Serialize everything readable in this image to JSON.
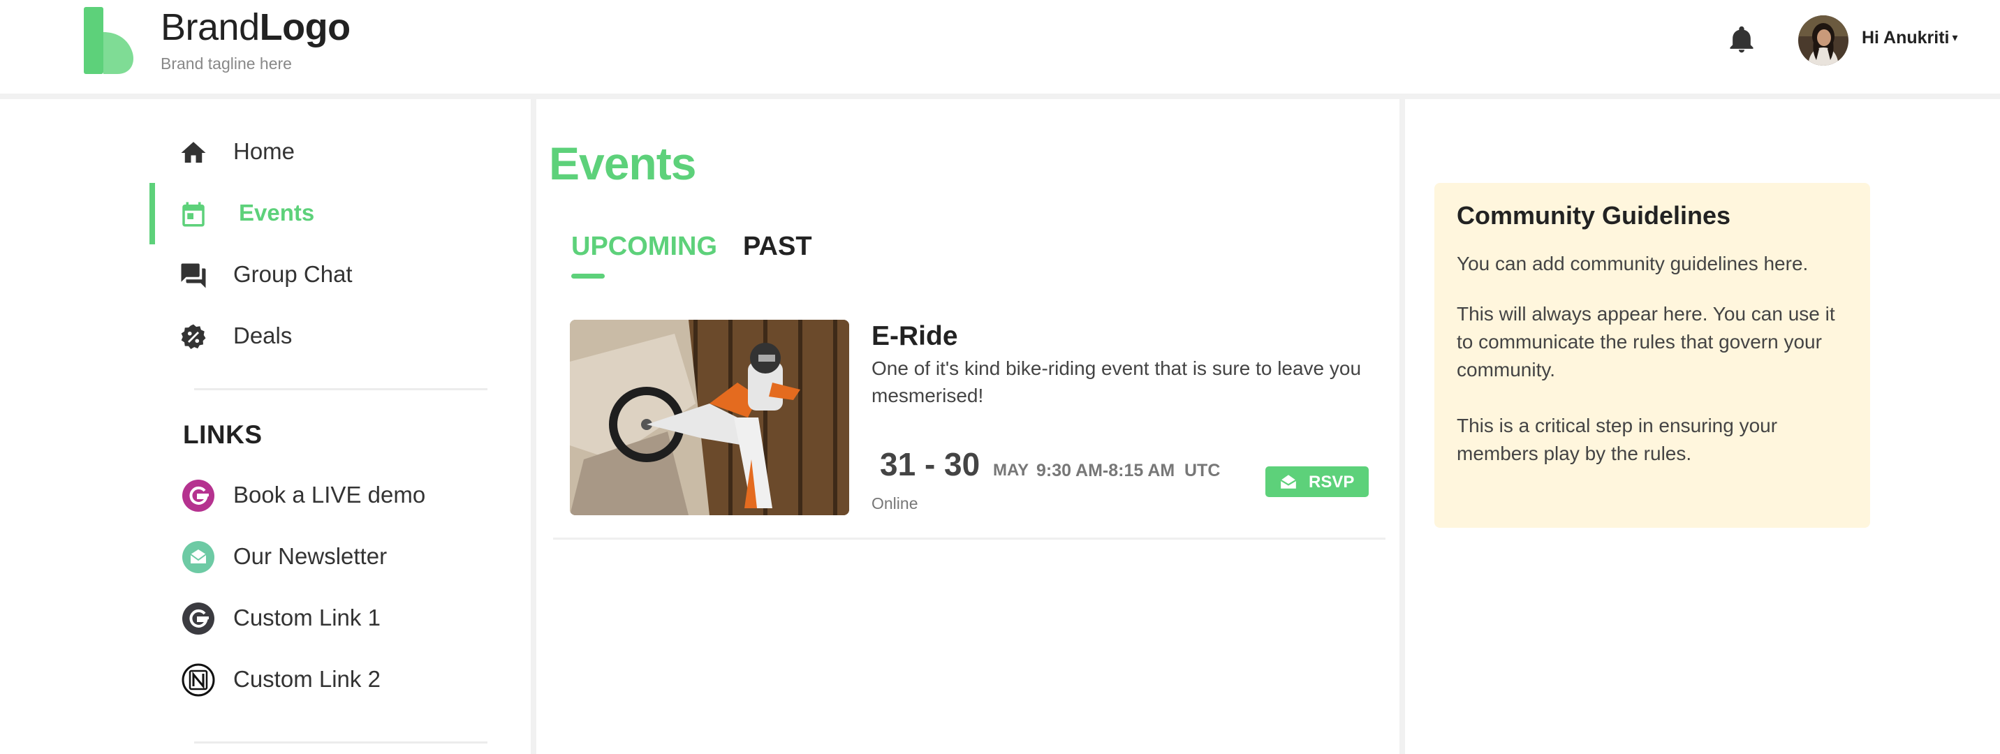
{
  "header": {
    "brand_regular": "Brand",
    "brand_bold": "Logo",
    "tagline": "Brand tagline here",
    "user_greeting": "Hi Anukriti",
    "caret": "▾"
  },
  "sidebar": {
    "items": [
      {
        "label": "Home",
        "icon": "home-icon"
      },
      {
        "label": "Events",
        "icon": "calendar-icon",
        "active": true
      },
      {
        "label": "Group Chat",
        "icon": "chat-icon"
      },
      {
        "label": "Deals",
        "icon": "discount-icon"
      }
    ],
    "links_heading": "LINKS",
    "links": [
      {
        "label": "Book a LIVE demo",
        "icon": "g-logo-magenta-icon"
      },
      {
        "label": "Our Newsletter",
        "icon": "mail-circle-icon"
      },
      {
        "label": "Custom Link 1",
        "icon": "g-logo-dark-icon"
      },
      {
        "label": "Custom Link 2",
        "icon": "notion-icon"
      }
    ]
  },
  "main": {
    "title": "Events",
    "tabs": [
      {
        "label": "UPCOMING",
        "active": true
      },
      {
        "label": "PAST",
        "active": false
      }
    ],
    "events": [
      {
        "title": "E-Ride",
        "description": "One of it's kind bike-riding event that is sure to leave you mesmerised!",
        "dates": "31 - 30",
        "month": "MAY",
        "time": "9:30 AM-8:15 AM",
        "timezone": "UTC",
        "location": "Online",
        "rsvp_label": "RSVP"
      }
    ]
  },
  "guidelines": {
    "title": "Community Guidelines",
    "paragraphs": [
      "You can add community guidelines here.",
      "This will always appear here. You can use it to communicate the rules that govern your community.",
      "This is a critical step in ensuring your members play by the rules."
    ]
  },
  "colors": {
    "accent": "#5dd17a",
    "guidelines_bg": "#fff6dd",
    "text_dark": "#222222"
  }
}
